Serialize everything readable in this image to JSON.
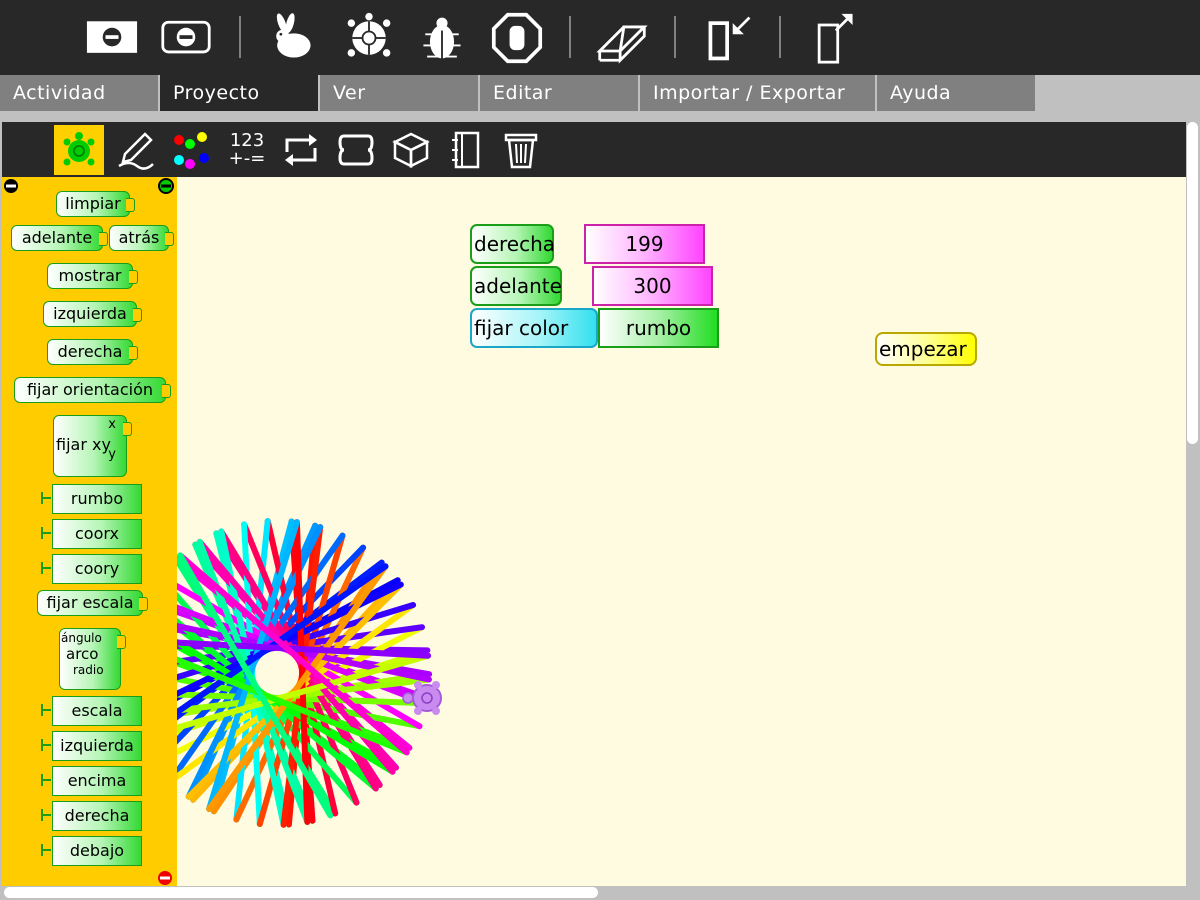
{
  "toolbar": {
    "buttons": [
      {
        "name": "hide-blocks",
        "icon": "hide-palette-icon"
      },
      {
        "name": "collapse",
        "icon": "collapse-blocks-icon"
      },
      {
        "name": "run-fast",
        "icon": "rabbit-icon"
      },
      {
        "name": "run-slow",
        "icon": "turtle-icon"
      },
      {
        "name": "debug",
        "icon": "bug-icon"
      },
      {
        "name": "stop",
        "icon": "stop-hand-icon"
      },
      {
        "name": "clear",
        "icon": "eraser-icon"
      },
      {
        "name": "load-samples",
        "icon": "import-icon"
      },
      {
        "name": "share",
        "icon": "export-icon"
      }
    ]
  },
  "tabs": [
    {
      "label": "Actividad"
    },
    {
      "label": "Proyecto"
    },
    {
      "label": "Ver"
    },
    {
      "label": "Editar"
    },
    {
      "label": "Importar / Exportar"
    },
    {
      "label": "Ayuda"
    }
  ],
  "palette_bar": {
    "numbers_label": "123\n+-="
  },
  "palette": {
    "blocks": [
      "limpiar",
      "adelante",
      "atrás",
      "mostrar",
      "izquierda",
      "derecha",
      "fijar orientación"
    ],
    "setxy": {
      "label": "fijar xy",
      "arg_x": "x",
      "arg_y": "y"
    },
    "reporters_a": [
      "rumbo",
      "coorx",
      "coory"
    ],
    "setscale": "fijar escala",
    "arc": {
      "label": "arco",
      "arg1": "ángulo",
      "arg2": "radio"
    },
    "reporters_b": [
      "escala",
      "izquierda",
      "encima",
      "derecha",
      "debajo"
    ]
  },
  "program": {
    "right": {
      "label": "derecha",
      "value": "199"
    },
    "forward": {
      "label": "adelante",
      "value": "300"
    },
    "setcolor": {
      "label": "fijar color",
      "value": "rumbo"
    },
    "start": {
      "label": "empezar"
    }
  },
  "colors": {
    "toolbar": "#282828",
    "tab_inactive": "#808080",
    "palette_bg": "#ffcc00",
    "canvas_bg": "#fefbe0",
    "turtle_block": "#33d933",
    "number_block": "#ff44ff"
  },
  "drawing": {
    "star_segments": 60,
    "turn_angle": 199
  }
}
